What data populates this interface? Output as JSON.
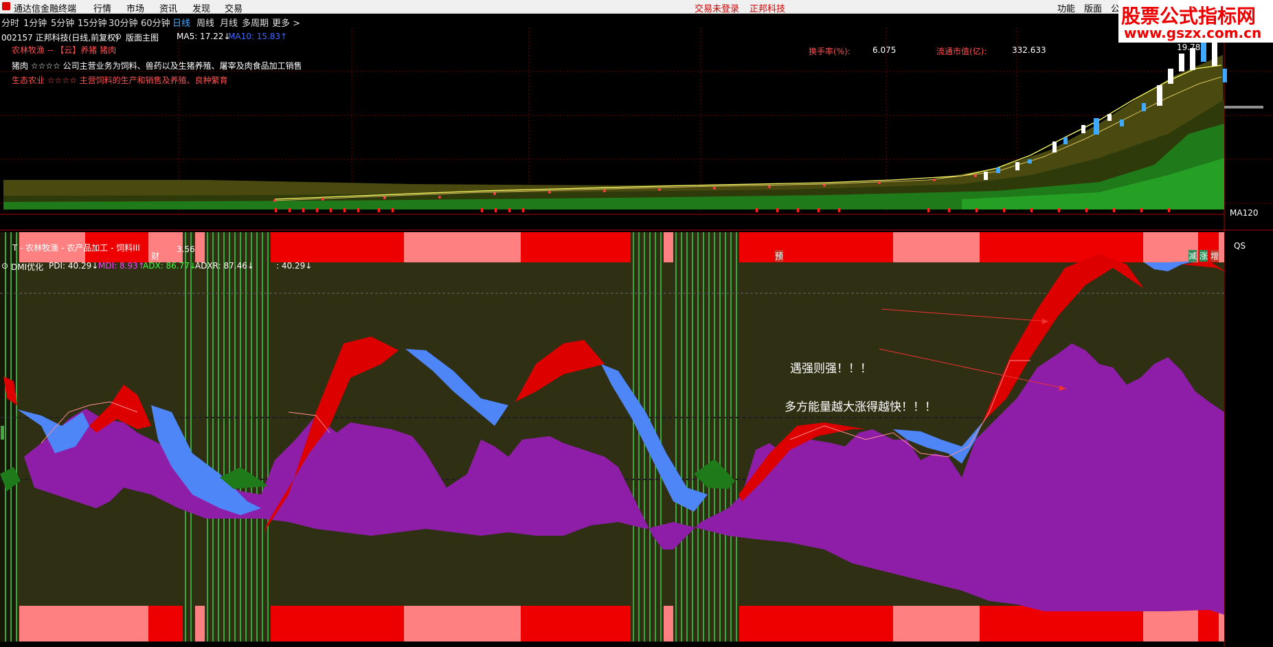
{
  "app": {
    "title": "通达信金融终端",
    "menu": [
      "行情",
      "市场",
      "资讯",
      "发现",
      "交易"
    ],
    "login_status": "交易未登录",
    "stock_tab": "正邦科技",
    "right_menu": [
      "功能",
      "版面",
      "公"
    ]
  },
  "watermark": {
    "line1": "股票公式指标网",
    "line2": "www.gszx.com.cn"
  },
  "periods": [
    "分时",
    "1分钟",
    "5分钟",
    "15分钟",
    "30分钟",
    "60分钟",
    "日线",
    "周线",
    "月线",
    "多周期",
    "更多 >"
  ],
  "active_period": "日线",
  "main_chart": {
    "stock_header": "002157 正邦科技(日线,前复权)",
    "layout_label": "版面主图",
    "ma5": "MA5: 17.22↓",
    "ma10": "MA10: 15.83↑",
    "sector_line1": "农林牧渔 -- 【云】养猪 猪肉",
    "sector_line2": "猪肉 ☆☆☆☆ 公司主营业务为饲料、兽药以及生猪养殖、屠宰及肉食品加工销售",
    "sector_line3": "生态农业 ☆☆☆☆ 主营饲料的生产和销售及养殖、良种繁育",
    "turnover_label": "换手率(%):",
    "turnover_value": "6.075",
    "float_cap_label": "流通市值(亿):",
    "float_cap_value": "332.633",
    "high_price": "19.78",
    "ma120_label": "MA120",
    "qs_label": "QS",
    "bottom_legend": "T - 农林牧渔 - 农产品加工 - 饲料III",
    "low_price": "3.56",
    "marker_cai": "财",
    "marker_yu": "预",
    "marker_jian": "减",
    "marker_zhang": "涨",
    "marker_zeng": "增"
  },
  "indicator": {
    "name": "DMI优化",
    "pdi": "PDI: 40.29↓",
    "mdi": "MDI: 8.93↑",
    "adx": "ADX: 86.77↓",
    "adxr": "ADXR: 87.46↓",
    "extra": ": 40.29↓",
    "annotation1": "遇强则强！！！",
    "annotation2": "多方能量越大涨得越快！！！"
  },
  "colors": {
    "up_red": "#ff2020",
    "pdi_red": "#dd0000",
    "mdi_blue": "#4f86f7",
    "adx_purple": "#8b1fa8",
    "grid_red": "#b00000"
  }
}
